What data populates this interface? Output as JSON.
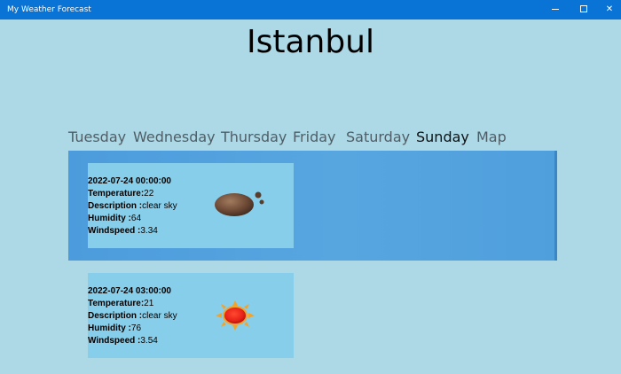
{
  "window": {
    "title": "My Weather Forecast",
    "controls": [
      "minimize-icon",
      "maximize-icon",
      "close-icon"
    ],
    "close_glyph": "✕"
  },
  "city": "Istanbul",
  "tabs": [
    {
      "label": "Tuesday"
    },
    {
      "label": "Wednesday"
    },
    {
      "label": "Thursday"
    },
    {
      "label": "Friday"
    },
    {
      "label": "Saturday"
    },
    {
      "label": "Sunday"
    },
    {
      "label": "Map"
    }
  ],
  "active_tab": "Sunday",
  "labels": {
    "temperature": "Temperature:",
    "description": "Description :",
    "humidity": "Humidity :",
    "windspeed": "Windspeed :"
  },
  "forecasts": [
    {
      "datetime": "2022-07-24 00:00:00",
      "temperature": "22",
      "description": "clear sky",
      "humidity": "64",
      "windspeed": "3.34",
      "icon": "clear-night-moon-icon",
      "selected": true
    },
    {
      "datetime": "2022-07-24 03:00:00",
      "temperature": "21",
      "description": "clear sky",
      "humidity": "76",
      "windspeed": "3.54",
      "icon": "clear-day-sun-icon",
      "selected": false
    }
  ],
  "colors": {
    "titlebar": "#0a74d6",
    "background": "#add8e6",
    "card": "#87ceeb",
    "selection": "#4f9fdd",
    "sun": "#e8231a",
    "moon": "#6e4a36"
  }
}
